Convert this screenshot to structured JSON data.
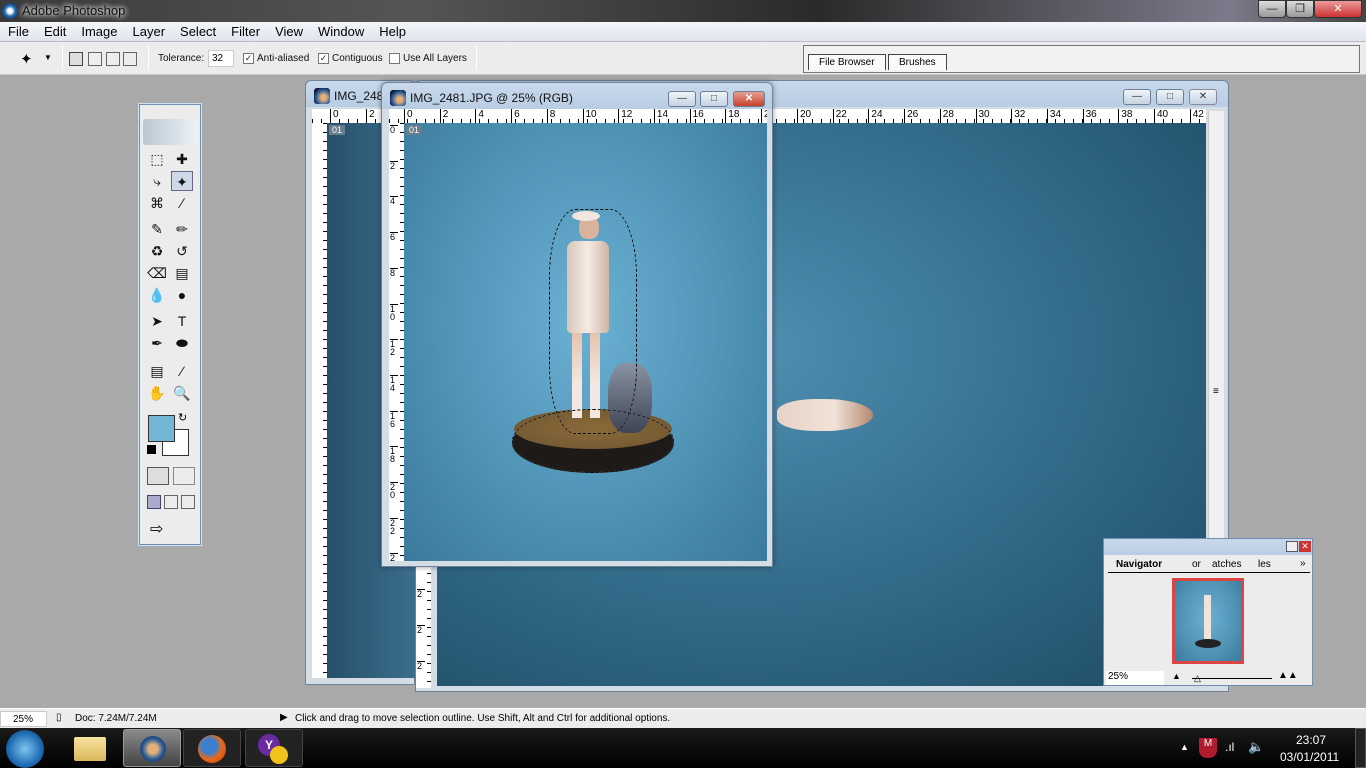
{
  "app": {
    "title": "Adobe Photoshop",
    "win_controls": [
      "minimize",
      "restore",
      "close"
    ]
  },
  "menu": [
    "File",
    "Edit",
    "Image",
    "Layer",
    "Select",
    "Filter",
    "View",
    "Window",
    "Help"
  ],
  "options": {
    "tool": "magic-wand",
    "tolerance_label": "Tolerance:",
    "tolerance": "32",
    "anti_aliased": {
      "label": "Anti-aliased",
      "checked": true
    },
    "contiguous": {
      "label": "Contiguous",
      "checked": true
    },
    "use_all_layers": {
      "label": "Use All Layers",
      "checked": false
    }
  },
  "palette_well": {
    "tabs": [
      "File Browser",
      "Brushes"
    ]
  },
  "documents": [
    {
      "title": "IMG_248",
      "ruler_top": [
        "0",
        "2"
      ],
      "badge": "01"
    },
    {
      "title": "",
      "ruler_top": [
        "20",
        "22",
        "24",
        "26",
        "28",
        "30",
        "32",
        "34",
        "36",
        "38",
        "40",
        "42"
      ],
      "ruler_left": [
        "2",
        "2",
        "2",
        "2",
        "3"
      ]
    },
    {
      "title": "IMG_2481.JPG @ 25% (RGB)",
      "ruler_top": [
        "0",
        "2",
        "4",
        "6",
        "8",
        "10",
        "12",
        "14",
        "16",
        "18",
        "20"
      ],
      "ruler_left": [
        "0",
        "2",
        "4",
        "6",
        "8",
        "1 0",
        "1 2",
        "1 4",
        "1 6",
        "1 8",
        "2 0",
        "2 2",
        "2 4"
      ],
      "badge": "01"
    }
  ],
  "colors": {
    "foreground": "#74b6d6",
    "background": "#ffffff",
    "canvas_bg": "#4f93b5"
  },
  "navigator": {
    "tabs": [
      "Navigator",
      "or",
      "atches",
      "les"
    ],
    "zoom": "25%"
  },
  "status": {
    "zoom": "25%",
    "doc": "Doc: 7.24M/7.24M",
    "hint": "Click and drag to move selection outline.  Use Shift, Alt and Ctrl for additional options."
  },
  "taskbar": {
    "apps": [
      "windows-explorer",
      "photoshop",
      "firefox",
      "yahoo-messenger"
    ],
    "time": "23:07",
    "date": "03/01/2011"
  }
}
